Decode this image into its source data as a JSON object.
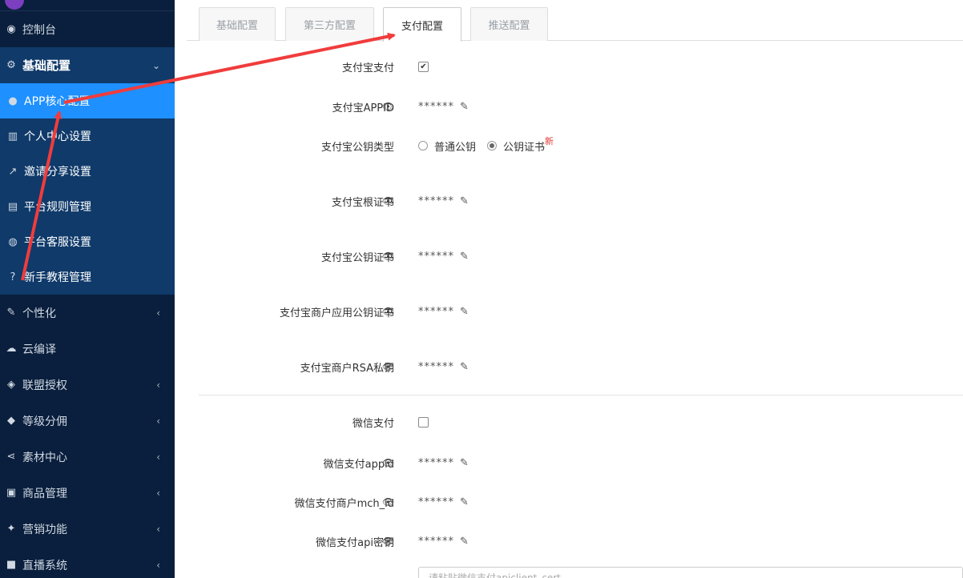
{
  "sidebar": {
    "items": [
      {
        "label": "控制台",
        "icon": "dashboard-icon",
        "glyph": "◉",
        "kind": "normal",
        "chevron": ""
      },
      {
        "label": "基础配置",
        "icon": "cogs-icon",
        "glyph": "⚙",
        "kind": "section",
        "chevron": "⌄"
      },
      {
        "label": "APP核心配置",
        "icon": "circle-dot-icon",
        "glyph": "●",
        "kind": "active",
        "chevron": ""
      },
      {
        "label": "个人中心设置",
        "icon": "bank-icon",
        "glyph": "▥",
        "kind": "sub",
        "chevron": ""
      },
      {
        "label": "邀请分享设置",
        "icon": "share-square-icon",
        "glyph": "↗",
        "kind": "sub",
        "chevron": ""
      },
      {
        "label": "平台规则管理",
        "icon": "file-icon",
        "glyph": "▤",
        "kind": "sub",
        "chevron": ""
      },
      {
        "label": "平台客服设置",
        "icon": "user-circle-icon",
        "glyph": "◍",
        "kind": "sub",
        "chevron": ""
      },
      {
        "label": "新手教程管理",
        "icon": "question-circle-icon",
        "glyph": "?",
        "kind": "sub",
        "chevron": ""
      },
      {
        "label": "个性化",
        "icon": "magic-wand-icon",
        "glyph": "✎",
        "kind": "normal",
        "chevron": "‹"
      },
      {
        "label": "云编译",
        "icon": "cloud-icon",
        "glyph": "☁",
        "kind": "normal",
        "chevron": ""
      },
      {
        "label": "联盟授权",
        "icon": "cubes-icon",
        "glyph": "◈",
        "kind": "normal",
        "chevron": "‹"
      },
      {
        "label": "等级分佣",
        "icon": "diamond-icon",
        "glyph": "◆",
        "kind": "normal",
        "chevron": "‹"
      },
      {
        "label": "素材中心",
        "icon": "share-alt-icon",
        "glyph": "⋖",
        "kind": "normal",
        "chevron": "‹"
      },
      {
        "label": "商品管理",
        "icon": "briefcase-icon",
        "glyph": "▣",
        "kind": "normal",
        "chevron": "‹"
      },
      {
        "label": "营销功能",
        "icon": "gift-icon",
        "glyph": "✦",
        "kind": "normal",
        "chevron": "‹"
      },
      {
        "label": "直播系统",
        "icon": "video-camera-icon",
        "glyph": "■",
        "kind": "normal",
        "chevron": "‹"
      }
    ]
  },
  "tabs": [
    {
      "label": "基础配置",
      "active": false
    },
    {
      "label": "第三方配置",
      "active": false
    },
    {
      "label": "支付配置",
      "active": true
    },
    {
      "label": "推送配置",
      "active": false
    }
  ],
  "form": {
    "alipay_enable_label": "支付宝支付",
    "alipay_enable_checked": "✔",
    "alipay_appid_label": "支付宝APPID",
    "alipay_key_type_label": "支付宝公钥类型",
    "key_type_options": [
      {
        "label": "普通公钥",
        "selected": false
      },
      {
        "label": "公钥证书",
        "selected": true
      }
    ],
    "new_badge": "新",
    "alipay_root_cert_label": "支付宝根证书",
    "alipay_pub_cert_label": "支付宝公钥证书",
    "alipay_merchant_cert_label": "支付宝商户应用公钥证书",
    "alipay_rsa_label": "支付宝商户RSA私钥",
    "wechat_enable_label": "微信支付",
    "wechat_appid_label": "微信支付appid",
    "wechat_mchid_label": "微信支付商户mch_id",
    "wechat_apikey_label": "微信支付api密钥",
    "masked_value": "******",
    "cert_placeholder": "请粘贴微信支付apiclient_cert"
  },
  "icons": {
    "eye": "eye-slash-icon",
    "edit": "edit-icon"
  },
  "colors": {
    "sidebar_bg": "#0a1f3d",
    "section_bg": "#0f3a6a",
    "active_bg": "#1e90ff",
    "annotation_arrow": "#f03c3c"
  }
}
